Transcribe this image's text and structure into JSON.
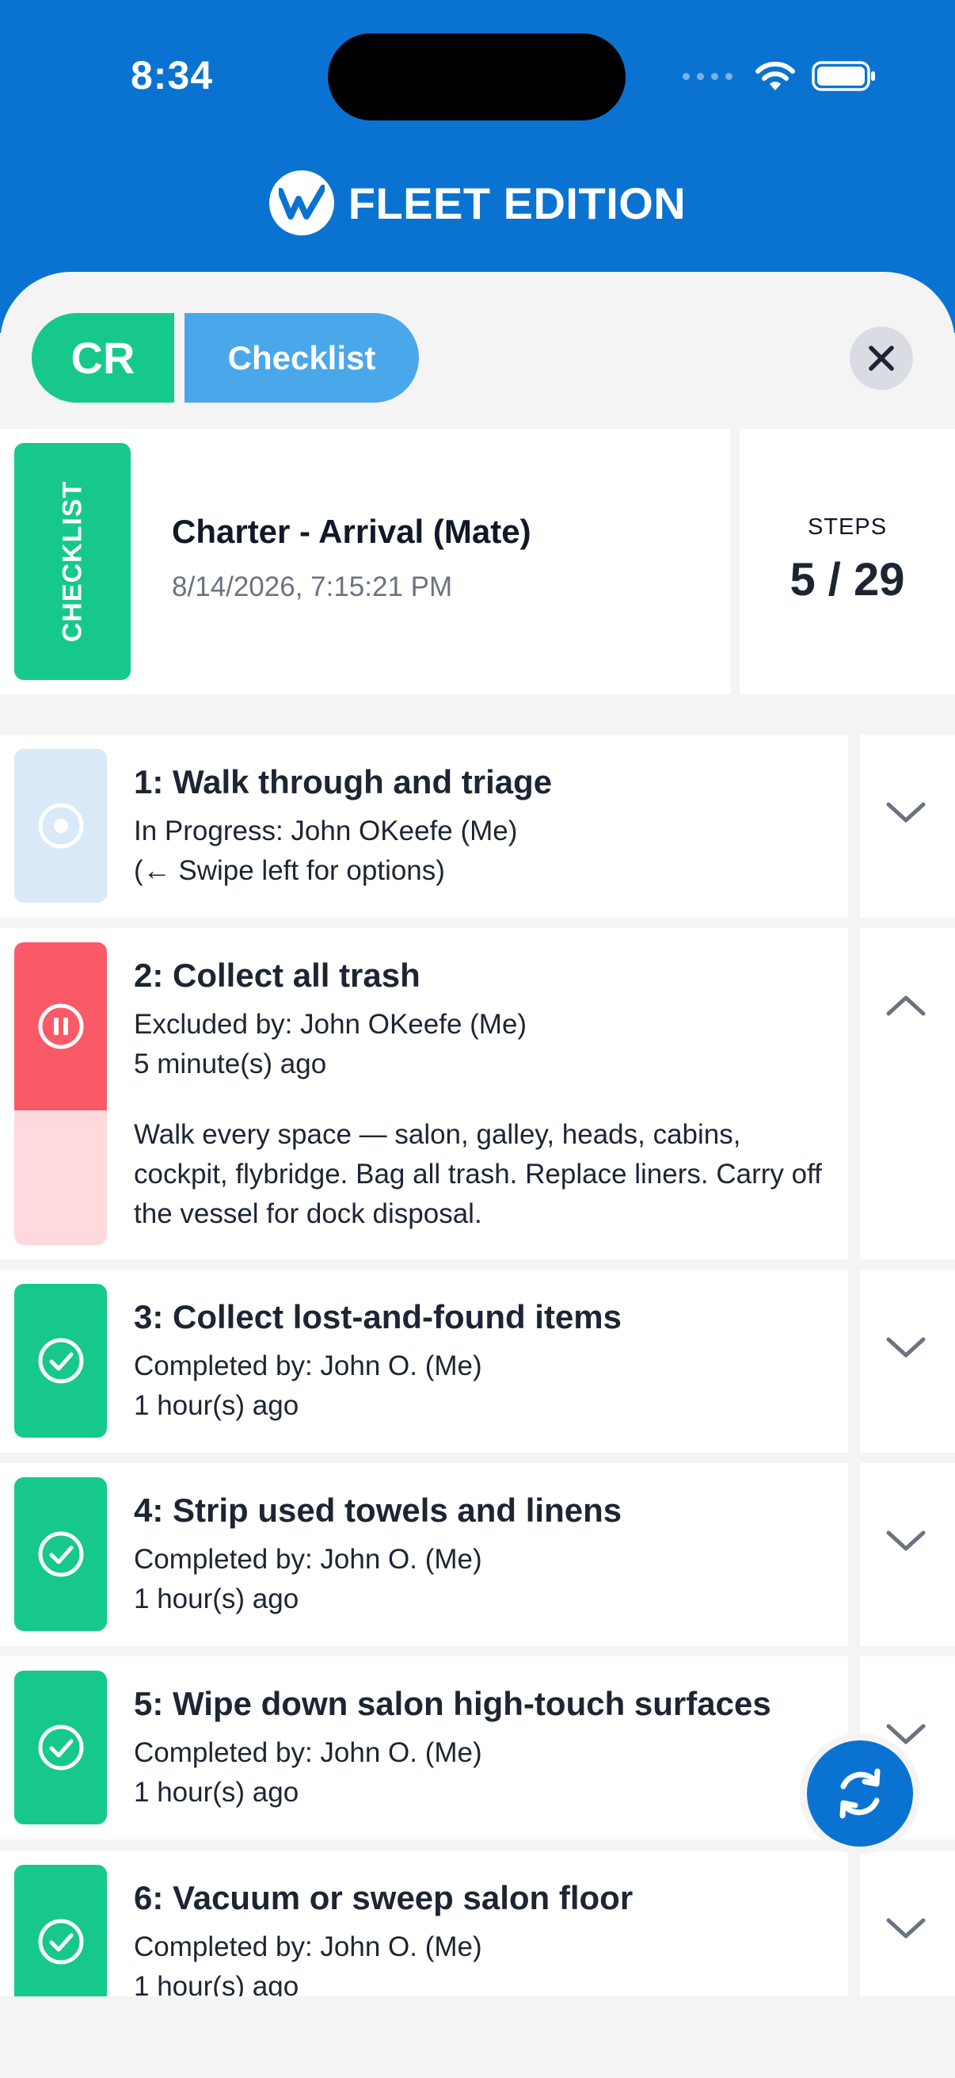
{
  "status_bar": {
    "time": "8:34"
  },
  "brand": {
    "name": "FLEET EDITION"
  },
  "chips": {
    "code": "CR",
    "type": "Checklist"
  },
  "summary": {
    "tag": "CHECKLIST",
    "title": "Charter - Arrival (Mate)",
    "date": "8/14/2026, 7:15:21 PM",
    "steps_label": "STEPS",
    "steps_value": "5 / 29"
  },
  "steps": [
    {
      "title": "1: Walk through and triage",
      "line1": "In Progress: John OKeefe (Me)",
      "line2": "(← Swipe left for options)",
      "status": "in-progress",
      "expanded": false
    },
    {
      "title": "2: Collect all trash",
      "line1": "Excluded by: John OKeefe (Me)",
      "line2": "5 minute(s) ago",
      "status": "excluded",
      "expanded": true,
      "description": "Walk every space — salon, galley, heads, cabins, cockpit, flybridge. Bag all trash. Replace liners. Carry off the vessel for dock disposal."
    },
    {
      "title": "3: Collect lost-and-found items",
      "line1": "Completed by: John O. (Me)",
      "line2": "1 hour(s) ago",
      "status": "completed",
      "expanded": false
    },
    {
      "title": "4: Strip used towels and linens",
      "line1": "Completed by: John O. (Me)",
      "line2": "1 hour(s) ago",
      "status": "completed",
      "expanded": false
    },
    {
      "title": "5: Wipe down salon high-touch surfaces",
      "line1": "Completed by: John O. (Me)",
      "line2": "1 hour(s) ago",
      "status": "completed",
      "expanded": false
    },
    {
      "title": "6: Vacuum or sweep salon floor",
      "line1": "Completed by: John O. (Me)",
      "line2": "1 hour(s) ago",
      "status": "completed",
      "expanded": false
    }
  ],
  "colors": {
    "header_blue": "#0a73d1",
    "completed_green": "#16c98a",
    "excluded_red": "#fa5a67",
    "in_progress_blue": "#d9e9f7",
    "chip_blue": "#4aa8ea"
  },
  "icons": {
    "close": "close-icon",
    "refresh": "refresh-icon",
    "in_progress": "target-icon",
    "excluded": "pause-icon",
    "completed": "check-circle-icon",
    "expand": "chevron-down-icon",
    "collapse": "chevron-up-icon"
  }
}
